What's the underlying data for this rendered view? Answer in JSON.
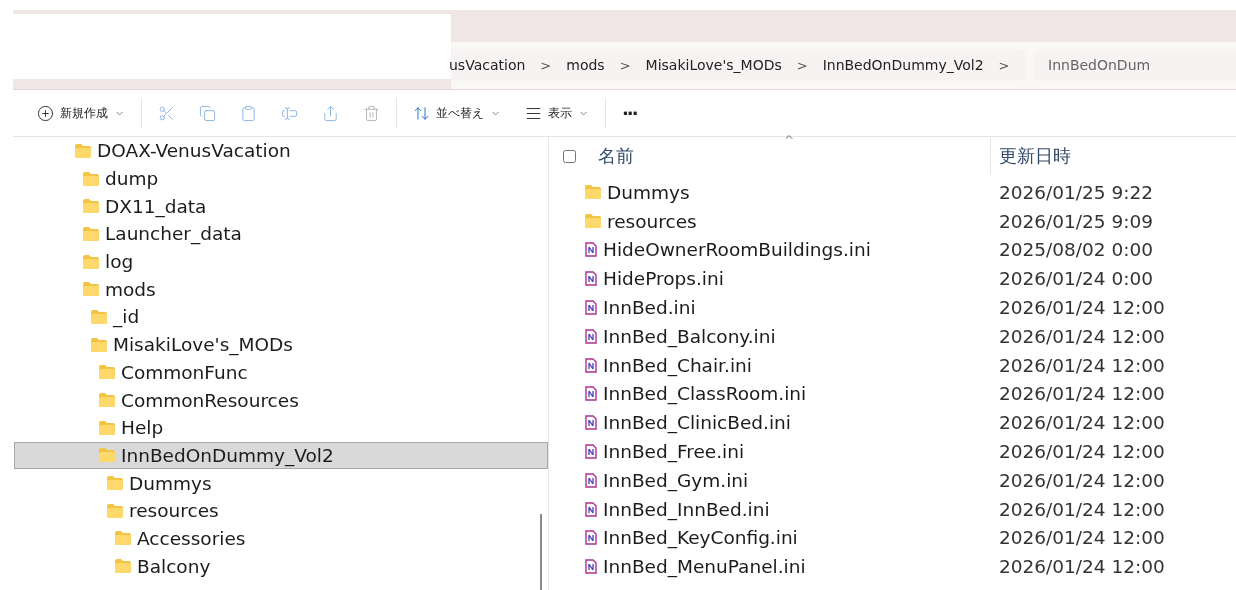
{
  "breadcrumb": {
    "items": [
      {
        "label": "usVacation"
      },
      {
        "label": "mods"
      },
      {
        "label": "MisakiLove's_MODs"
      },
      {
        "label": "InnBedOnDummy_Vol2"
      }
    ],
    "separator": ">"
  },
  "search": {
    "placeholder": "InnBedOnDum"
  },
  "toolbar": [
    {
      "kind": "new",
      "label": "新規作成",
      "disabled": false
    },
    {
      "kind": "cut",
      "disabled": true
    },
    {
      "kind": "copy",
      "disabled": true
    },
    {
      "kind": "paste",
      "disabled": true
    },
    {
      "kind": "rename",
      "disabled": true
    },
    {
      "kind": "share",
      "disabled": true
    },
    {
      "kind": "delete",
      "disabled": true
    },
    {
      "kind": "sort",
      "label": "並べ替え",
      "disabled": false
    },
    {
      "kind": "view",
      "label": "表示",
      "disabled": false
    },
    {
      "kind": "more",
      "label": "···",
      "disabled": false
    }
  ],
  "tree": [
    {
      "label": "DOAX-VenusVacation",
      "selected": false,
      "children": [
        {
          "label": "dump",
          "selected": false
        },
        {
          "label": "DX11_data",
          "selected": false
        },
        {
          "label": "Launcher_data",
          "selected": false
        },
        {
          "label": "log",
          "selected": false
        },
        {
          "label": "mods",
          "selected": false,
          "children": [
            {
              "label": "_id",
              "selected": false
            },
            {
              "label": "MisakiLove's_MODs",
              "selected": false,
              "children": [
                {
                  "label": "CommonFunc",
                  "selected": false
                },
                {
                  "label": "CommonResources",
                  "selected": false
                },
                {
                  "label": "Help",
                  "selected": false
                },
                {
                  "label": "InnBedOnDummy_Vol2",
                  "selected": true,
                  "children": [
                    {
                      "label": "Dummys",
                      "selected": false
                    },
                    {
                      "label": "resources",
                      "selected": false,
                      "children": [
                        {
                          "label": "Accessories",
                          "selected": false
                        },
                        {
                          "label": "Balcony",
                          "selected": false
                        }
                      ]
                    }
                  ]
                }
              ]
            }
          ]
        }
      ]
    }
  ],
  "table": {
    "select_all": {
      "checked": false
    },
    "columns": [
      "名前",
      "更新日時"
    ],
    "rows": [
      {
        "kind": "folder",
        "name": "Dummys",
        "date": "2026/01/25 9:22"
      },
      {
        "kind": "folder",
        "name": "resources",
        "date": "2026/01/25 9:09"
      },
      {
        "kind": "ini",
        "name": "HideOwnerRoomBuildings.ini",
        "date": "2025/08/02 0:00"
      },
      {
        "kind": "ini",
        "name": "HideProps.ini",
        "date": "2026/01/24 0:00"
      },
      {
        "kind": "ini",
        "name": "InnBed.ini",
        "date": "2026/01/24 12:00"
      },
      {
        "kind": "ini",
        "name": "InnBed_Balcony.ini",
        "date": "2026/01/24 12:00"
      },
      {
        "kind": "ini",
        "name": "InnBed_Chair.ini",
        "date": "2026/01/24 12:00"
      },
      {
        "kind": "ini",
        "name": "InnBed_ClassRoom.ini",
        "date": "2026/01/24 12:00"
      },
      {
        "kind": "ini",
        "name": "InnBed_ClinicBed.ini",
        "date": "2026/01/24 12:00"
      },
      {
        "kind": "ini",
        "name": "InnBed_Free.ini",
        "date": "2026/01/24 12:00"
      },
      {
        "kind": "ini",
        "name": "InnBed_Gym.ini",
        "date": "2026/01/24 12:00"
      },
      {
        "kind": "ini",
        "name": "InnBed_InnBed.ini",
        "date": "2026/01/24 12:00"
      },
      {
        "kind": "ini",
        "name": "InnBed_KeyConfig.ini",
        "date": "2026/01/24 12:00"
      },
      {
        "kind": "ini",
        "name": "InnBed_MenuPanel.ini",
        "date": "2026/01/24 12:00"
      }
    ]
  }
}
